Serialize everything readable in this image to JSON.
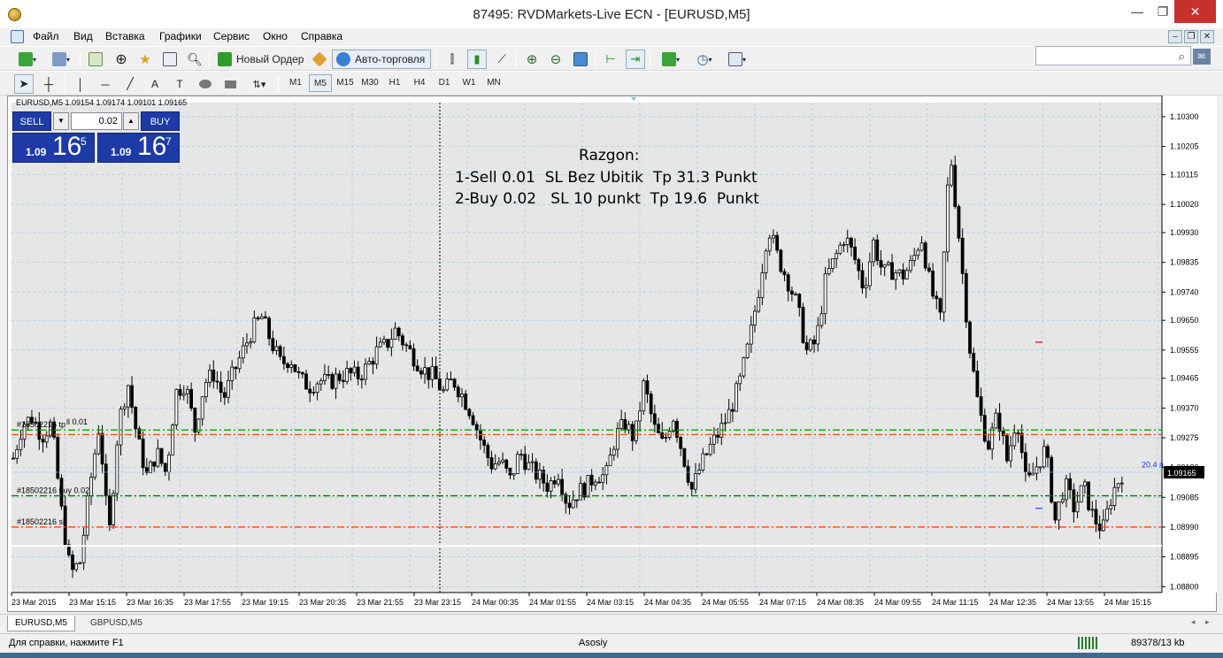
{
  "window": {
    "title": "87495: RVDMarkets-Live ECN - [EURUSD,M5]",
    "minimize": "—",
    "restore": "❐",
    "close": "✕"
  },
  "menu": [
    "Файл",
    "Вид",
    "Вставка",
    "Графики",
    "Сервис",
    "Окно",
    "Справка"
  ],
  "toolbar": {
    "new_order": "Новый Ордер",
    "auto_trading": "Авто-торговля",
    "timeframes": [
      "M1",
      "M5",
      "M15",
      "M30",
      "H1",
      "H4",
      "D1",
      "W1",
      "MN"
    ],
    "active_timeframe": "M5",
    "draw_text_tool": "A"
  },
  "chart_info": "EURUSD,M5  1.09154 1.09174 1.09101 1.09165",
  "trade_panel": {
    "sell_label": "SELL",
    "buy_label": "BUY",
    "lot": "0.02",
    "sell_price_prefix": "1.09",
    "sell_price_big": "16",
    "sell_price_sup": "5",
    "buy_price_prefix": "1.09",
    "buy_price_big": "16",
    "buy_price_sup": "7"
  },
  "annotation": {
    "line1": "Razgon:",
    "line2": "1-Sell 0.01  SL Bez Ubitik  Tp 31.3 Punkt",
    "line3": "2-Buy 0.02   SL 10 punkt  Tp 19.6  Punkt"
  },
  "chart_data": {
    "type": "candlestick",
    "symbol": "EURUSD",
    "timeframe": "M5",
    "y_ticks": [
      "1.10300",
      "1.10205",
      "1.10115",
      "1.10020",
      "1.09930",
      "1.09835",
      "1.09740",
      "1.09650",
      "1.09555",
      "1.09465",
      "1.09370",
      "1.09275",
      "1.09180",
      "1.09085",
      "1.08990",
      "1.08895",
      "1.08800"
    ],
    "ylim": [
      1.08781,
      1.10345
    ],
    "x_ticks": [
      "23 Mar 2015",
      "23 Mar 15:15",
      "23 Mar 16:35",
      "23 Mar 17:55",
      "23 Mar 19:15",
      "23 Mar 20:35",
      "23 Mar 21:55",
      "23 Mar 23:15",
      "24 Mar 00:35",
      "24 Mar 01:55",
      "24 Mar 03:15",
      "24 Mar 04:35",
      "24 Mar 05:55",
      "24 Mar 07:15",
      "24 Mar 08:35",
      "24 Mar 09:55",
      "24 Mar 11:15",
      "24 Mar 12:35",
      "24 Mar 13:55",
      "24 Mar 15:15"
    ],
    "current_price": "1.09165",
    "price_path": [
      1.0921,
      1.0932,
      1.0934,
      1.0928,
      1.0932,
      1.0905,
      1.0884,
      1.0888,
      1.0912,
      1.0932,
      1.0895,
      1.0932,
      1.0945,
      1.0927,
      1.0915,
      1.0923,
      1.0916,
      1.0942,
      1.0945,
      1.093,
      1.0945,
      1.0948,
      1.094,
      1.0948,
      1.0955,
      1.0962,
      1.0966,
      1.0958,
      1.0951,
      1.0953,
      1.0946,
      1.0944,
      1.0946,
      1.0945,
      1.0947,
      1.0948,
      1.0947,
      1.095,
      1.0955,
      1.0957,
      1.0962,
      1.0957,
      1.0953,
      1.0949,
      1.0947,
      1.0942,
      1.0946,
      1.0941,
      1.0935,
      1.0926,
      1.0919,
      1.092,
      1.0914,
      1.0923,
      1.0918,
      1.0915,
      1.0912,
      1.0917,
      1.0906,
      1.091,
      1.0912,
      1.0916,
      1.0915,
      1.0928,
      1.0932,
      1.0927,
      1.0945,
      1.0931,
      1.0925,
      1.0935,
      1.0923,
      1.0911,
      1.0919,
      1.0925,
      1.093,
      1.0936,
      1.0945,
      1.0958,
      1.0975,
      1.0995,
      1.0985,
      1.0978,
      1.097,
      1.0955,
      1.0958,
      1.0978,
      1.0985,
      1.0992,
      1.0985,
      1.0975,
      1.099,
      1.098,
      1.0981,
      1.0979,
      1.0983,
      1.0992,
      1.0975,
      1.0965,
      1.102,
      1.099,
      1.0958,
      1.0937,
      1.0925,
      1.0935,
      1.092,
      1.0935,
      1.0912,
      1.0918,
      1.0924,
      1.0901,
      1.0913,
      1.0905,
      1.0912,
      1.0902,
      1.0898,
      1.091,
      1.0916
    ],
    "levels": [
      {
        "label": "#18502216 tp",
        "extra": "ll 0.01",
        "price": 1.093,
        "color": "#00aa00",
        "style": "dash-dot"
      },
      {
        "label": "",
        "price": 1.09285,
        "color": "#e0541c",
        "style": "dash-dot"
      },
      {
        "label": "#18502216 buy 0.02",
        "price": 1.0909,
        "color": "#008000",
        "style": "dash-dot"
      },
      {
        "label": "#18502216 sl",
        "price": 1.0899,
        "color": "#ff4500",
        "style": "dash-dot"
      },
      {
        "label": "",
        "price": 1.0893,
        "color": "#ffffff",
        "style": "solid"
      }
    ],
    "distance_label": "20.4 п",
    "vertical_marker_time": "23 Mar 23:15",
    "grid": true
  },
  "tabs": [
    "EURUSD,M5",
    "GBPUSD,M5"
  ],
  "status": {
    "help": "Для справки, нажмите F1",
    "profile": "Asosiy",
    "traffic": "89378/13 kb"
  },
  "icons": {
    "search": "search-icon",
    "new_order": "new-order-icon",
    "auto_trading": "auto-trading-icon"
  }
}
